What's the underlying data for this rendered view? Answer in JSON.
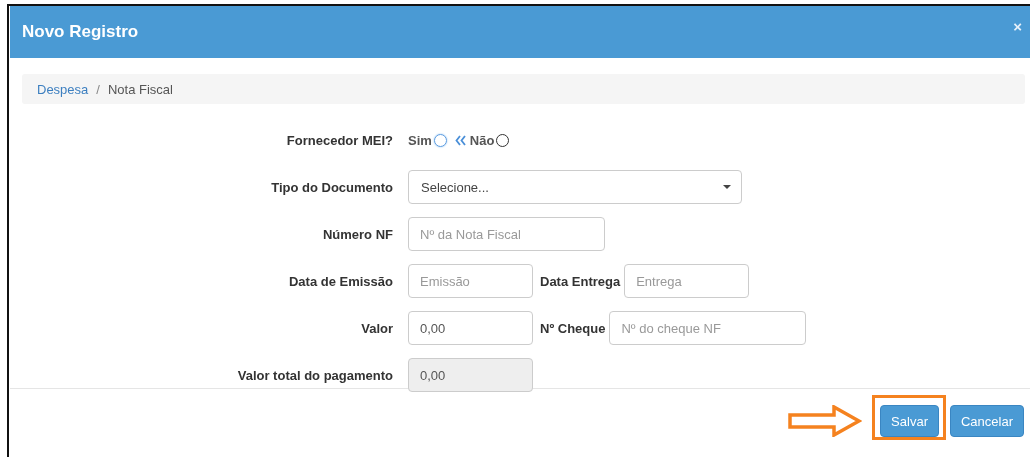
{
  "dialog": {
    "title": "Novo Registro",
    "close": "×"
  },
  "breadcrumb": [
    {
      "label": "Despesa",
      "kind": "link"
    },
    {
      "label": "/",
      "kind": "separator"
    },
    {
      "label": "Nota Fiscal",
      "kind": "current"
    }
  ],
  "form": {
    "rows": [
      {
        "kind": "radio",
        "label": "Fornecedor MEI?",
        "options": [
          {
            "label": "Sim",
            "selected": false
          },
          {
            "label": "Não",
            "selected": false
          }
        ]
      },
      {
        "kind": "select",
        "label": "Tipo do Documento",
        "value": "Selecione..."
      },
      {
        "kind": "text",
        "label": "Número NF",
        "fields": [
          {
            "placeholder": "Nº da Nota Fiscal",
            "disabled": false
          }
        ]
      },
      {
        "kind": "text",
        "label": "Data de Emissão",
        "fields": [
          {
            "placeholder": "Emissão",
            "disabled": false
          },
          {
            "label": "Data Entrega",
            "placeholder": "Entrega",
            "disabled": false
          }
        ]
      },
      {
        "kind": "text",
        "label": "Valor",
        "fields": [
          {
            "value": "0,00",
            "disabled": false
          },
          {
            "label": "Nº Cheque",
            "placeholder": "Nº do cheque NF",
            "disabled": false
          }
        ]
      },
      {
        "kind": "text",
        "label": "Valor total do pagamento",
        "fields": [
          {
            "value": "0,00",
            "disabled": true
          }
        ]
      }
    ]
  },
  "footer": {
    "buttons": [
      {
        "label": "Salvar",
        "kind": "primary",
        "highlighted": true
      },
      {
        "label": "Cancelar",
        "kind": "primary",
        "highlighted": false
      }
    ]
  }
}
